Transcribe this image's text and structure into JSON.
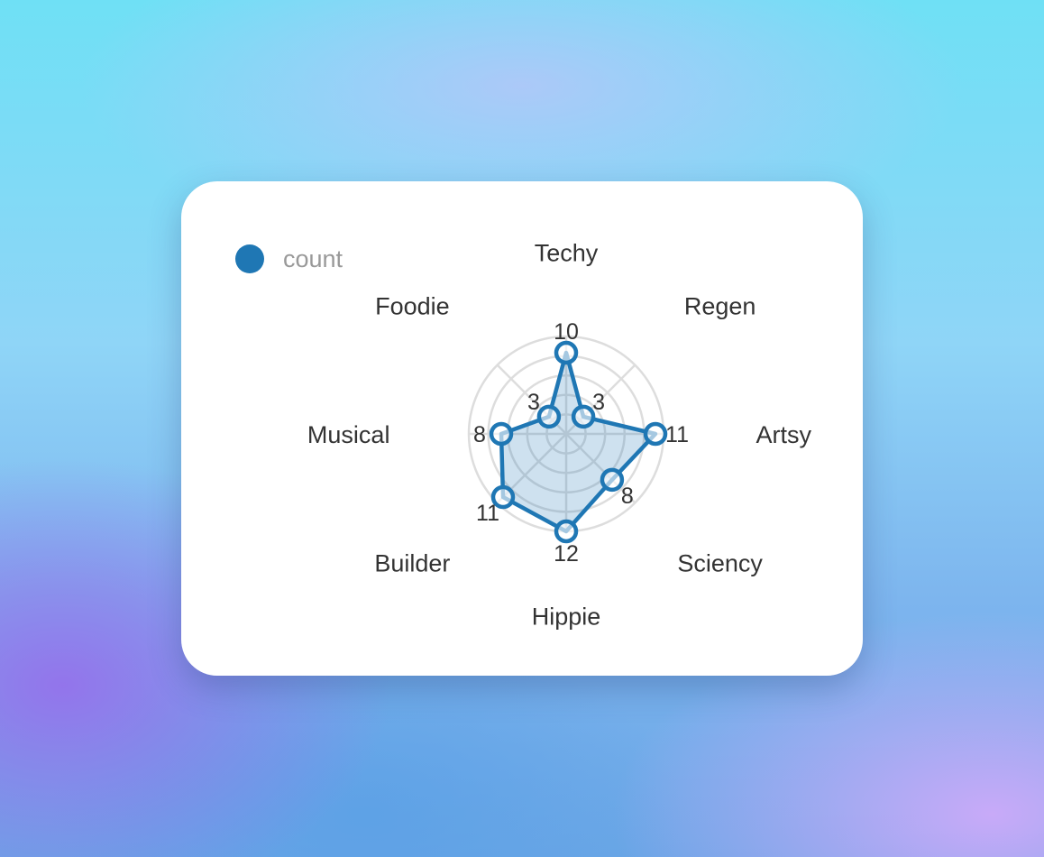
{
  "legend": {
    "label": "count",
    "color": "#1f77b4"
  },
  "chart_data": {
    "type": "radar",
    "categories": [
      "Techy",
      "Regen",
      "Artsy",
      "Sciency",
      "Hippie",
      "Builder",
      "Musical",
      "Foodie"
    ],
    "series": [
      {
        "name": "count",
        "values": [
          10,
          3,
          11,
          8,
          12,
          11,
          8,
          3
        ],
        "color": "#1f77b4"
      }
    ],
    "rmax": 12,
    "grid": true,
    "legend_position": "top-left"
  }
}
